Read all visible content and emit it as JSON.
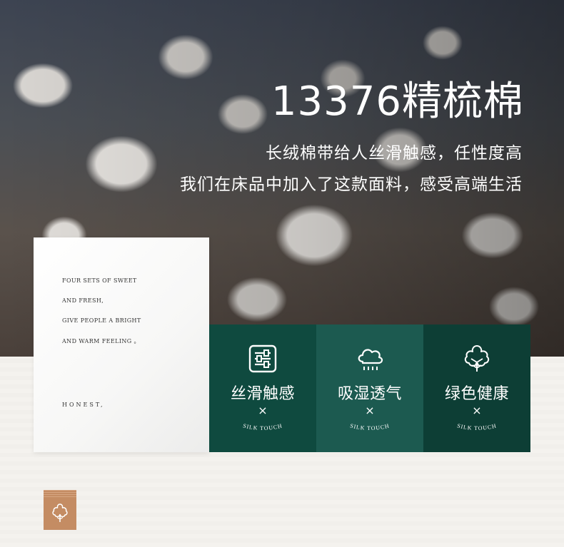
{
  "hero": {
    "title": "13376精梳棉",
    "line1": "长绒棉带给人丝滑触感，任性度高",
    "line2": "我们在床品中加入了这款面料，感受高端生活"
  },
  "card": {
    "line1": "FOUR SETS OF SWEET",
    "line2": "AND FRESH,",
    "line3": "GIVE PEOPLE A BRIGHT",
    "line4": "AND WARM FEELING 。",
    "sign": "HONEST,"
  },
  "features": [
    {
      "icon": "sliders-icon",
      "title": "丝滑触感",
      "mark": "×",
      "sub": "SILK TOUCH",
      "color": "#0f4a3f"
    },
    {
      "icon": "cloud-rain-icon",
      "title": "吸湿透气",
      "mark": "×",
      "sub": "SILK TOUCH",
      "color": "#1c5a50"
    },
    {
      "icon": "cotton-flower-icon",
      "title": "绿色健康",
      "mark": "×",
      "sub": "SILK TOUCH",
      "color": "#0d3e35"
    }
  ],
  "badge": {
    "icon": "cotton-flower-icon",
    "color": "#c48c63"
  }
}
